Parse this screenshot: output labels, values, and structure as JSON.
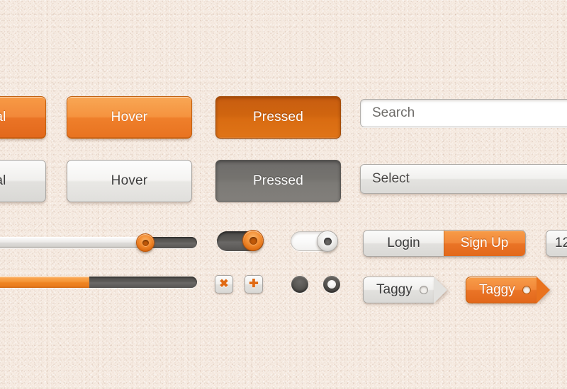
{
  "theme": {
    "background": "#f7ebe1",
    "accent_orange": "#ea7426",
    "accent_orange_pressed": "#cf6310",
    "gray_pressed": "#77756f",
    "text_dark": "#3b3b3b",
    "text_light": "#ffffff"
  },
  "buttons": {
    "orange_row": [
      {
        "label": "al",
        "state": "normal",
        "note_truncated": true
      },
      {
        "label": "Hover",
        "state": "hover"
      },
      {
        "label": "Pressed",
        "state": "pressed"
      }
    ],
    "gray_row": [
      {
        "label": "al",
        "state": "normal",
        "note_truncated": true
      },
      {
        "label": "Hover",
        "state": "hover"
      },
      {
        "label": "Pressed",
        "state": "pressed"
      }
    ]
  },
  "inputs": {
    "search": {
      "placeholder": "Search",
      "value": ""
    },
    "select": {
      "value": "Select"
    }
  },
  "sliders": {
    "slider": {
      "value": 70,
      "min": 0,
      "max": 100
    },
    "progress": {
      "value": 45,
      "min": 0,
      "max": 100
    }
  },
  "toggles": [
    {
      "state": "on",
      "knob": "orange"
    },
    {
      "state": "off",
      "knob": "gray"
    }
  ],
  "icon_buttons": [
    {
      "glyph": "✖",
      "name": "close-icon"
    },
    {
      "glyph": "✚",
      "name": "plus-icon"
    }
  ],
  "radios": [
    {
      "state": "unselected"
    },
    {
      "state": "selected"
    }
  ],
  "segmented": {
    "options": [
      {
        "label": "Login",
        "active": false
      },
      {
        "label": "Sign Up",
        "active": true
      }
    ]
  },
  "stepper": {
    "value": "12"
  },
  "tags": [
    {
      "label": "Taggy",
      "style": "gray"
    },
    {
      "label": "Taggy",
      "style": "orange"
    }
  ]
}
